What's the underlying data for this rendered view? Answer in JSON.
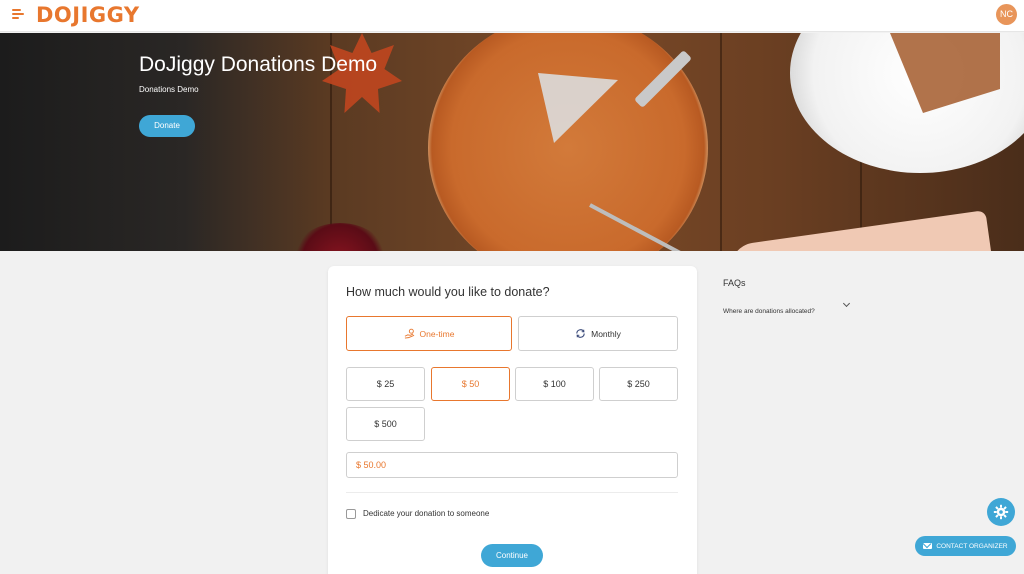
{
  "header": {
    "logo": "DOJIGGY",
    "avatar_initials": "NC",
    "menu_icon": "hamburger-menu-icon"
  },
  "hero": {
    "title": "DoJiggy Donations Demo",
    "subtitle": "Donations Demo",
    "button_label": "Donate"
  },
  "donation": {
    "question": "How much would you like to donate?",
    "frequency": {
      "one_time_label": "One-time",
      "monthly_label": "Monthly",
      "selected": "One-time"
    },
    "amounts": [
      "$ 25",
      "$ 50",
      "$ 100",
      "$ 250",
      "$ 500"
    ],
    "selected_amount": "$ 50",
    "amount_input_value": "$ 50.00",
    "dedicate_label": "Dedicate your donation to someone",
    "dedicate_checked": false,
    "continue_label": "Continue"
  },
  "faq": {
    "title": "FAQs",
    "items": [
      {
        "question": "Where are donations allocated?"
      }
    ]
  },
  "floating": {
    "settings_icon": "gear-icon",
    "contact_label": "CONTACT ORGANIZER"
  },
  "colors": {
    "brand_orange": "#e8772e",
    "accent_blue": "#3fa7d6",
    "avatar_bg": "#e8955a"
  }
}
